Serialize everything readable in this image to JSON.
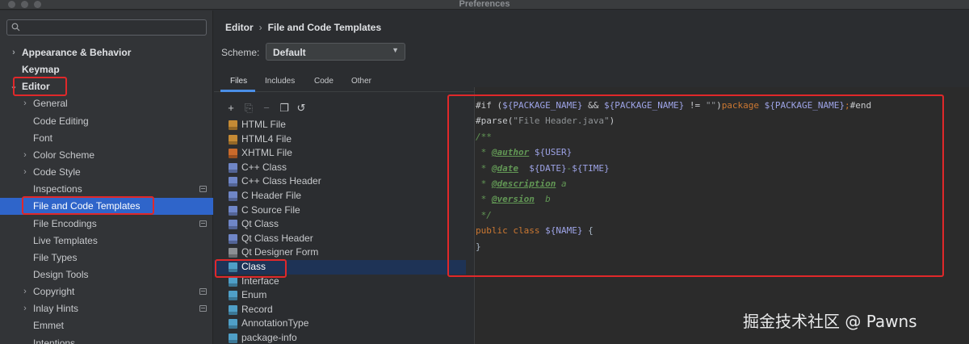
{
  "window": {
    "title": "Preferences"
  },
  "sidebar": {
    "items": [
      {
        "label": "Appearance & Behavior",
        "chevron": "›",
        "bold": true
      },
      {
        "label": "Keymap",
        "chevron": "",
        "bold": true
      },
      {
        "label": "Editor",
        "chevron": "⌄",
        "bold": true
      },
      {
        "label": "General",
        "chevron": "›",
        "bold": false
      },
      {
        "label": "Code Editing",
        "chevron": "",
        "bold": false
      },
      {
        "label": "Font",
        "chevron": "",
        "bold": false
      },
      {
        "label": "Color Scheme",
        "chevron": "›",
        "bold": false
      },
      {
        "label": "Code Style",
        "chevron": "›",
        "bold": false
      },
      {
        "label": "Inspections",
        "chevron": "",
        "bold": false,
        "gear": true
      },
      {
        "label": "File and Code Templates",
        "chevron": "",
        "bold": false,
        "selected": true
      },
      {
        "label": "File Encodings",
        "chevron": "",
        "bold": false,
        "gear": true
      },
      {
        "label": "Live Templates",
        "chevron": "",
        "bold": false
      },
      {
        "label": "File Types",
        "chevron": "",
        "bold": false
      },
      {
        "label": "Design Tools",
        "chevron": "",
        "bold": false
      },
      {
        "label": "Copyright",
        "chevron": "›",
        "bold": false,
        "gear": true
      },
      {
        "label": "Inlay Hints",
        "chevron": "›",
        "bold": false,
        "gear": true
      },
      {
        "label": "Emmet",
        "chevron": "",
        "bold": false
      },
      {
        "label": "Intentions",
        "chevron": "",
        "bold": false
      }
    ]
  },
  "breadcrumb": {
    "parent": "Editor",
    "separator": "›",
    "current": "File and Code Templates"
  },
  "scheme": {
    "label": "Scheme:",
    "value": "Default"
  },
  "tabs": [
    "Files",
    "Includes",
    "Code",
    "Other"
  ],
  "toolbar": {
    "add": "+",
    "copy": "⎘",
    "remove": "−",
    "duplicate": "❐",
    "reset": "↺"
  },
  "templates": [
    {
      "label": "HTML File",
      "icon_color": "#c48a35"
    },
    {
      "label": "HTML4 File",
      "icon_color": "#c48a35"
    },
    {
      "label": "XHTML File",
      "icon_color": "#c96a2b"
    },
    {
      "label": "C++ Class",
      "icon_color": "#6f86c7"
    },
    {
      "label": "C++ Class Header",
      "icon_color": "#6f86c7"
    },
    {
      "label": "C Header File",
      "icon_color": "#6f86c7"
    },
    {
      "label": "C Source File",
      "icon_color": "#6f86c7"
    },
    {
      "label": "Qt Class",
      "icon_color": "#6f86c7"
    },
    {
      "label": "Qt Class Header",
      "icon_color": "#6f86c7"
    },
    {
      "label": "Qt Designer Form",
      "icon_color": "#8c8f93"
    },
    {
      "label": "Class",
      "icon_color": "#4f9fc7",
      "selected": true
    },
    {
      "label": "Interface",
      "icon_color": "#4f9fc7"
    },
    {
      "label": "Enum",
      "icon_color": "#4f9fc7"
    },
    {
      "label": "Record",
      "icon_color": "#4f9fc7"
    },
    {
      "label": "AnnotationType",
      "icon_color": "#4f9fc7"
    },
    {
      "label": "package-info",
      "icon_color": "#4f9fc7"
    }
  ],
  "code": {
    "lines": [
      [
        [
          "dir",
          "#if ("
        ],
        [
          "var",
          "${PACKAGE_NAME}"
        ],
        [
          "dir",
          " && "
        ],
        [
          "var",
          "${PACKAGE_NAME}"
        ],
        [
          "dir",
          " != "
        ],
        [
          "str",
          "\"\""
        ],
        [
          "dir",
          ")"
        ],
        [
          "kw",
          "package "
        ],
        [
          "var",
          "${PACKAGE_NAME}"
        ],
        [
          "kw",
          ";"
        ],
        [
          "dir",
          "#end"
        ]
      ],
      [
        [
          "dir",
          "#parse("
        ],
        [
          "str",
          "\"File Header.java\""
        ],
        [
          "dir",
          ")"
        ]
      ],
      [
        [
          "cmt",
          "/**"
        ]
      ],
      [
        [
          "cmt",
          " * "
        ],
        [
          "tag",
          "@author"
        ],
        [
          "cmt",
          " "
        ],
        [
          "var",
          "${USER}"
        ]
      ],
      [
        [
          "cmt",
          " * "
        ],
        [
          "tag",
          "@date"
        ],
        [
          "cmt",
          "  "
        ],
        [
          "var",
          "${DATE}"
        ],
        [
          "cmt",
          "-"
        ],
        [
          "var",
          "${TIME}"
        ]
      ],
      [
        [
          "cmt",
          " * "
        ],
        [
          "tag",
          "@description"
        ],
        [
          "cmt",
          " a"
        ]
      ],
      [
        [
          "cmt",
          " * "
        ],
        [
          "tag",
          "@version"
        ],
        [
          "cmt",
          "  b"
        ]
      ],
      [
        [
          "cmt",
          " */"
        ]
      ],
      [
        [
          "kw",
          "public class "
        ],
        [
          "var",
          "${NAME}"
        ],
        [
          "plain",
          " {"
        ]
      ],
      [
        [
          "plain",
          "}"
        ]
      ]
    ]
  },
  "watermark": "掘金技术社区 @ Pawns",
  "colors": {
    "selection": "#2f65ca",
    "highlight_box": "#e0282a",
    "tab_underline": "#4a8ee6"
  }
}
